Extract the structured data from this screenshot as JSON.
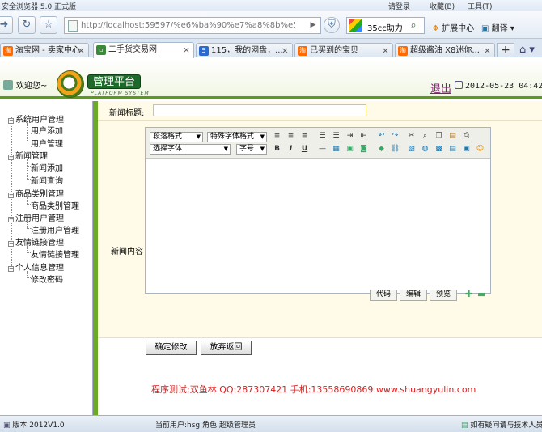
{
  "browser": {
    "title": "安全浏览器 5.0 正式版",
    "login": "请登录",
    "favorites": "收藏(B)",
    "tools": "工具(T)",
    "address": "http://localhost:59597/%e6%ba%90%e7%a8%8b%e5%",
    "address_host": "localhost",
    "search_text": "35cc助力",
    "ext_center": "扩展中心",
    "translate": "翻译"
  },
  "tabs": [
    {
      "label": "淘宝网 - 卖家中心",
      "icon_color": "#ff6a00"
    },
    {
      "label": "二手货交易网",
      "icon_color": "#3a8a3a",
      "active": true
    },
    {
      "label": "115，我的网盘，...",
      "icon_color": "#2a6ad0"
    },
    {
      "label": "已买到的宝贝",
      "icon_color": "#ff6a00"
    },
    {
      "label": "超级酱油 X8迷你...",
      "icon_color": "#ff6a00"
    }
  ],
  "app": {
    "welcome": "欢迎您~",
    "brand": "管理平台",
    "brand_sub": "PLATFORM SYSTEM",
    "logout": "退出",
    "datetime": "2012-05-23 04:42:",
    "accent": "#5a9a1e"
  },
  "menu": [
    {
      "label": "系统用户管理",
      "children": [
        "用户添加",
        "用户管理"
      ]
    },
    {
      "label": "新闻管理",
      "children": [
        "新闻添加",
        "新闻查询"
      ]
    },
    {
      "label": "商品类别管理",
      "children": [
        "商品类别管理"
      ]
    },
    {
      "label": "注册用户管理",
      "children": [
        "注册用户管理"
      ]
    },
    {
      "label": "友情链接管理",
      "children": [
        "友情链接管理"
      ]
    },
    {
      "label": "个人信息管理",
      "children": [
        "修改密码"
      ]
    }
  ],
  "form": {
    "title_label": "新闻标题:",
    "title_value": "",
    "content_label": "新闻内容",
    "para_format": "段落格式",
    "special_font": "特殊字体格式",
    "font_family": "选择字体",
    "font_size": "字号",
    "editor_tabs": [
      "代码",
      "编辑",
      "预览"
    ],
    "confirm": "确定修改",
    "cancel": "放弃返回"
  },
  "footer": "程序测试:双鱼林 QQ:287307421 手机:13558690869 www.shuangyulin.com",
  "status": {
    "version": "版本 2012V1.0",
    "current_user": "当前用户:hsg 角色:超级管理员",
    "hint": "如有疑问请与技术人员"
  }
}
